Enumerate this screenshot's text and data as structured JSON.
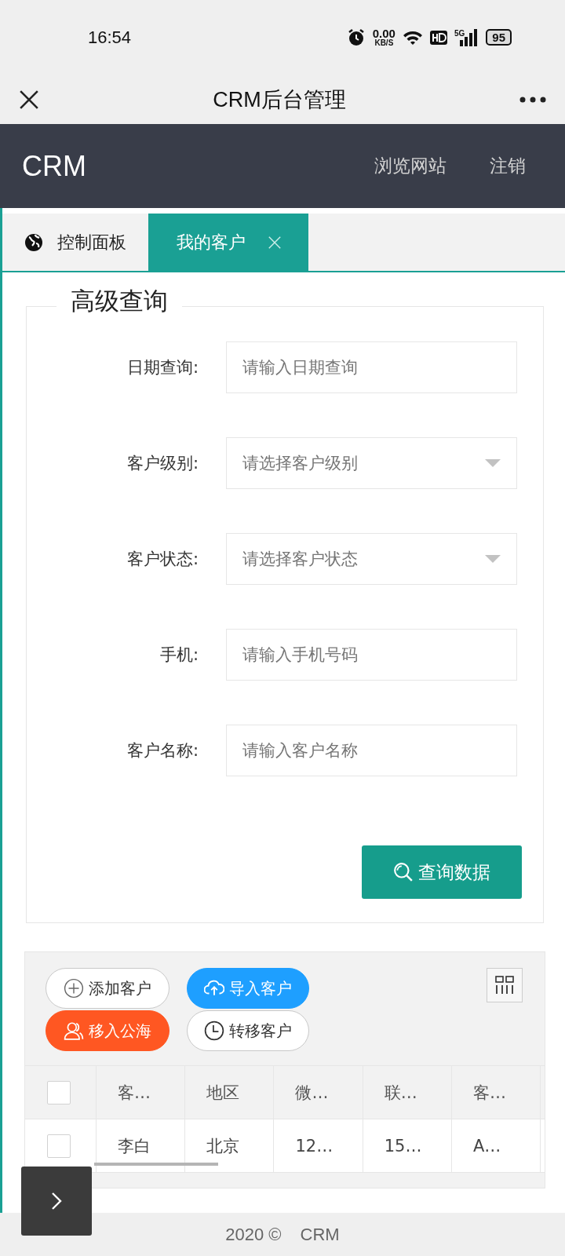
{
  "status_bar": {
    "time": "16:54",
    "net_speed": "0.00",
    "net_unit": "KB/S",
    "network": "5G",
    "battery": "95"
  },
  "app_bar": {
    "title": "CRM后台管理"
  },
  "nav": {
    "brand": "CRM",
    "links": [
      "浏览网站",
      "注销"
    ]
  },
  "tabs": [
    {
      "label": "控制面板",
      "selected": false,
      "closable": false
    },
    {
      "label": "我的客户",
      "selected": true,
      "closable": true
    }
  ],
  "search_form": {
    "legend": "高级查询",
    "fields": [
      {
        "label": "日期查询:",
        "placeholder": "请输入日期查询",
        "kind": "text"
      },
      {
        "label": "客户级别:",
        "placeholder": "请选择客户级别",
        "kind": "select"
      },
      {
        "label": "客户状态:",
        "placeholder": "请选择客户状态",
        "kind": "select"
      },
      {
        "label": "手机:",
        "placeholder": "请输入手机号码",
        "kind": "text"
      },
      {
        "label": "客户名称:",
        "placeholder": "请输入客户名称",
        "kind": "text"
      }
    ],
    "submit": "查询数据"
  },
  "table": {
    "toolbar_buttons": [
      {
        "label": "添加客户",
        "kind": "add"
      },
      {
        "label": "导入客户",
        "kind": "import"
      },
      {
        "label": "移入公海",
        "kind": "move"
      },
      {
        "label": "转移客户",
        "kind": "transfer"
      }
    ],
    "header_checked": false,
    "columns": [
      "客…",
      "地区",
      "微…",
      "联…",
      "客…"
    ],
    "rows": [
      {
        "checked": false,
        "cells": [
          "李白",
          "北京",
          "12…",
          "15…",
          "A…"
        ]
      }
    ]
  },
  "footer": {
    "copyright": "2020 ©",
    "brand": "CRM"
  }
}
